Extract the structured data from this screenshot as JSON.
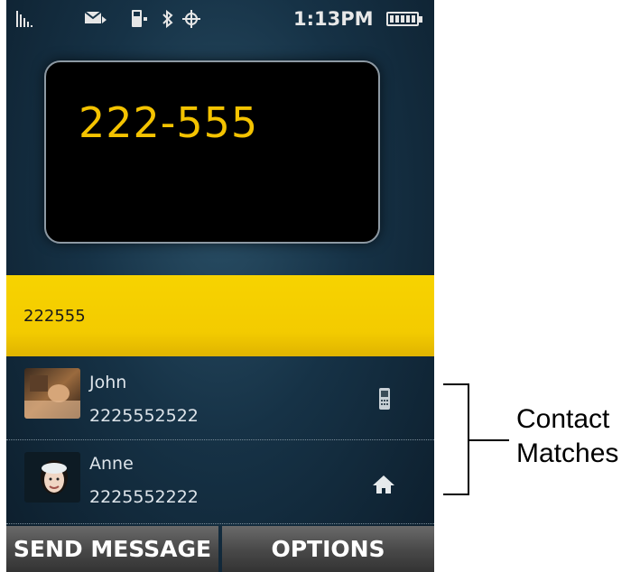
{
  "status_bar": {
    "time": "1:13PM",
    "icons": [
      "signal-icon",
      "message-icon",
      "phone-device-icon",
      "bluetooth-icon",
      "gps-icon",
      "battery-icon"
    ]
  },
  "dialer": {
    "display_number": "222-555",
    "input_value": "222555"
  },
  "contacts": [
    {
      "name": "John",
      "number": "2225552522",
      "type_icon": "mobile-icon"
    },
    {
      "name": "Anne",
      "number": "2225552222",
      "type_icon": "home-icon"
    }
  ],
  "softkeys": {
    "left": "SEND MESSAGE",
    "right": "OPTIONS"
  },
  "annotation": {
    "line1": "Contact",
    "line2": "Matches"
  },
  "colors": {
    "accent": "#f4c300",
    "background": "#163246"
  }
}
